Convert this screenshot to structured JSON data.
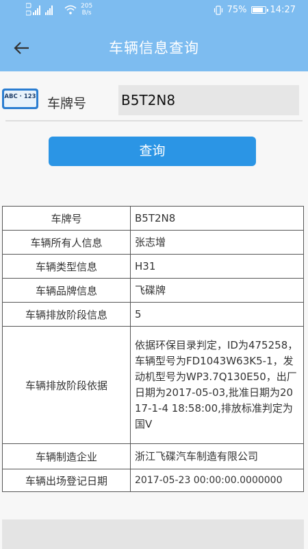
{
  "status_bar": {
    "speed_value": "205",
    "speed_unit": "B/s",
    "battery": "75%",
    "time": "14:27",
    "battery_level": 0.75
  },
  "header": {
    "title": "车辆信息查询",
    "back_icon": "arrow-left-icon"
  },
  "search": {
    "plate_icon_text": "ABC · 123",
    "label": "车牌号",
    "value": "B5T2N8",
    "button_label": "查询"
  },
  "table": {
    "rows": [
      {
        "key": "车牌号",
        "value": "B5T2N8"
      },
      {
        "key": "车辆所有人信息",
        "value": "张志增"
      },
      {
        "key": "车辆类型信息",
        "value": "H31"
      },
      {
        "key": "车辆品牌信息",
        "value": "飞碟牌"
      },
      {
        "key": "车辆排放阶段信息",
        "value": "5"
      },
      {
        "key": "车辆排放阶段依据",
        "value": "依据环保目录判定，ID为475258，车辆型号为FD1043W63K5-1，发动机型号为WP3.7Q130E50，出厂日期为2017-05-03,批准日期为2017-1-4 18:58:00,排放标准判定为国V"
      },
      {
        "key": "车辆制造企业",
        "value": "浙江飞碟汽车制造有限公司"
      },
      {
        "key": "车辆出场登记日期",
        "value": "2017-05-23 00:00:00.0000000"
      }
    ]
  },
  "colors": {
    "header_bg": "#7dbcf0",
    "button_bg": "#2b95e5"
  }
}
